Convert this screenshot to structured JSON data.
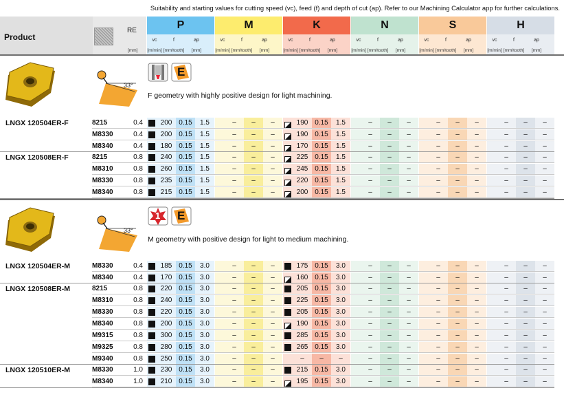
{
  "header_note": "Suitability and starting values for cutting speed (vc), feed (f) and depth of cut (ap). Refer to our Machining Calculator app for further calculations.",
  "columns": {
    "product": "Product",
    "re": "RE",
    "re_unit": "[mm]",
    "sub_labels": [
      "vc",
      "f",
      "ap"
    ],
    "sub_units": [
      "[m/min]",
      "[mm/tooth]",
      "[mm]"
    ]
  },
  "materials": [
    {
      "letter": "P",
      "header_color": "#6cc3f0",
      "sub_color": "#d9eefb",
      "cell_color": "#e6f3fc",
      "dark_color": "#bfe1f6"
    },
    {
      "letter": "M",
      "header_color": "#fdec6e",
      "sub_color": "#fdf6c8",
      "cell_color": "#fdf8da",
      "dark_color": "#f9ee9c"
    },
    {
      "letter": "K",
      "header_color": "#f26a4b",
      "sub_color": "#fbd3c7",
      "cell_color": "#fce1d8",
      "dark_color": "#f7b8a5"
    },
    {
      "letter": "N",
      "header_color": "#bfe2cf",
      "sub_color": "#e5f2ea",
      "cell_color": "#eaf5ee",
      "dark_color": "#cfe8da"
    },
    {
      "letter": "S",
      "header_color": "#f9c99a",
      "sub_color": "#fde7d2",
      "cell_color": "#fdeedf",
      "dark_color": "#f9d7b5"
    },
    {
      "letter": "H",
      "header_color": "#d6dde6",
      "sub_color": "#e9edf2",
      "cell_color": "#eef1f5",
      "dark_color": "#dde3ea"
    }
  ],
  "colors": {
    "black_mark": "#111111",
    "diag_mark_fill": "#ffffff",
    "separator": "#6f6f6f",
    "insert_gold": "#e3b81a",
    "insert_dark": "#8f6a08",
    "angle_fill": "#f3a632",
    "badge_orange": "#f39a2b",
    "badge_red": "#d7262d"
  },
  "sections": [
    {
      "geometry_text": "F geometry with highly positive design for light machining.",
      "angle_label": "33°",
      "badge_text": "E",
      "extra_icon": "turning-tool-icon",
      "groups": [
        {
          "product": "LNGX 120504ER-F",
          "rows": [
            {
              "grade": "8215",
              "re": "0.4",
              "p": {
                "mark": "square",
                "vc": "200",
                "f": "0.15",
                "ap": "1.5"
              },
              "k": {
                "mark": "diag",
                "vc": "190",
                "f": "0.15",
                "ap": "1.5"
              }
            },
            {
              "grade": "M8330",
              "re": "0.4",
              "p": {
                "mark": "square",
                "vc": "200",
                "f": "0.15",
                "ap": "1.5"
              },
              "k": {
                "mark": "diag",
                "vc": "190",
                "f": "0.15",
                "ap": "1.5"
              }
            },
            {
              "grade": "M8340",
              "re": "0.4",
              "p": {
                "mark": "square",
                "vc": "180",
                "f": "0.15",
                "ap": "1.5"
              },
              "k": {
                "mark": "diag",
                "vc": "170",
                "f": "0.15",
                "ap": "1.5"
              }
            }
          ]
        },
        {
          "product": "LNGX 120508ER-F",
          "rows": [
            {
              "grade": "8215",
              "re": "0.8",
              "p": {
                "mark": "square",
                "vc": "240",
                "f": "0.15",
                "ap": "1.5"
              },
              "k": {
                "mark": "diag",
                "vc": "225",
                "f": "0.15",
                "ap": "1.5"
              }
            },
            {
              "grade": "M8310",
              "re": "0.8",
              "p": {
                "mark": "square",
                "vc": "260",
                "f": "0.15",
                "ap": "1.5"
              },
              "k": {
                "mark": "diag",
                "vc": "245",
                "f": "0.15",
                "ap": "1.5"
              }
            },
            {
              "grade": "M8330",
              "re": "0.8",
              "p": {
                "mark": "square",
                "vc": "235",
                "f": "0.15",
                "ap": "1.5"
              },
              "k": {
                "mark": "diag",
                "vc": "220",
                "f": "0.15",
                "ap": "1.5"
              }
            },
            {
              "grade": "M8340",
              "re": "0.8",
              "p": {
                "mark": "square",
                "vc": "215",
                "f": "0.15",
                "ap": "1.5"
              },
              "k": {
                "mark": "diag",
                "vc": "200",
                "f": "0.15",
                "ap": "1.5"
              }
            }
          ]
        }
      ]
    },
    {
      "geometry_text": "M geometry with positive design for light to medium machining.",
      "angle_label": "33°",
      "badge_text": "E",
      "star_text": "1",
      "groups": [
        {
          "product": "LNGX 120504ER-M",
          "rows": [
            {
              "grade": "M8330",
              "re": "0.4",
              "p": {
                "mark": "square",
                "vc": "185",
                "f": "0.15",
                "ap": "3.0"
              },
              "k": {
                "mark": "square",
                "vc": "175",
                "f": "0.15",
                "ap": "3.0"
              }
            },
            {
              "grade": "M8340",
              "re": "0.4",
              "p": {
                "mark": "square",
                "vc": "170",
                "f": "0.15",
                "ap": "3.0"
              },
              "k": {
                "mark": "diag",
                "vc": "160",
                "f": "0.15",
                "ap": "3.0"
              }
            }
          ]
        },
        {
          "product": "LNGX 120508ER-M",
          "rows": [
            {
              "grade": "8215",
              "re": "0.8",
              "p": {
                "mark": "square",
                "vc": "220",
                "f": "0.15",
                "ap": "3.0"
              },
              "k": {
                "mark": "square",
                "vc": "205",
                "f": "0.15",
                "ap": "3.0"
              }
            },
            {
              "grade": "M8310",
              "re": "0.8",
              "p": {
                "mark": "square",
                "vc": "240",
                "f": "0.15",
                "ap": "3.0"
              },
              "k": {
                "mark": "square",
                "vc": "225",
                "f": "0.15",
                "ap": "3.0"
              }
            },
            {
              "grade": "M8330",
              "re": "0.8",
              "p": {
                "mark": "square",
                "vc": "220",
                "f": "0.15",
                "ap": "3.0"
              },
              "k": {
                "mark": "square",
                "vc": "205",
                "f": "0.15",
                "ap": "3.0"
              }
            },
            {
              "grade": "M8340",
              "re": "0.8",
              "p": {
                "mark": "square",
                "vc": "200",
                "f": "0.15",
                "ap": "3.0"
              },
              "k": {
                "mark": "diag",
                "vc": "190",
                "f": "0.15",
                "ap": "3.0"
              }
            },
            {
              "grade": "M9315",
              "re": "0.8",
              "p": {
                "mark": "square",
                "vc": "300",
                "f": "0.15",
                "ap": "3.0"
              },
              "k": {
                "mark": "square",
                "vc": "285",
                "f": "0.15",
                "ap": "3.0"
              }
            },
            {
              "grade": "M9325",
              "re": "0.8",
              "p": {
                "mark": "square",
                "vc": "280",
                "f": "0.15",
                "ap": "3.0"
              },
              "k": {
                "mark": "square",
                "vc": "265",
                "f": "0.15",
                "ap": "3.0"
              }
            },
            {
              "grade": "M9340",
              "re": "0.8",
              "p": {
                "mark": "square",
                "vc": "250",
                "f": "0.15",
                "ap": "3.0"
              },
              "k": {
                "mark": "none",
                "vc": "–",
                "f": "–",
                "ap": "–"
              }
            }
          ]
        },
        {
          "product": "LNGX 120510ER-M",
          "rows": [
            {
              "grade": "M8330",
              "re": "1.0",
              "p": {
                "mark": "square",
                "vc": "230",
                "f": "0.15",
                "ap": "3.0"
              },
              "k": {
                "mark": "square",
                "vc": "215",
                "f": "0.15",
                "ap": "3.0"
              }
            },
            {
              "grade": "M8340",
              "re": "1.0",
              "p": {
                "mark": "square",
                "vc": "210",
                "f": "0.15",
                "ap": "3.0"
              },
              "k": {
                "mark": "diag",
                "vc": "195",
                "f": "0.15",
                "ap": "3.0"
              }
            }
          ]
        }
      ]
    }
  ],
  "empty_value": "–"
}
